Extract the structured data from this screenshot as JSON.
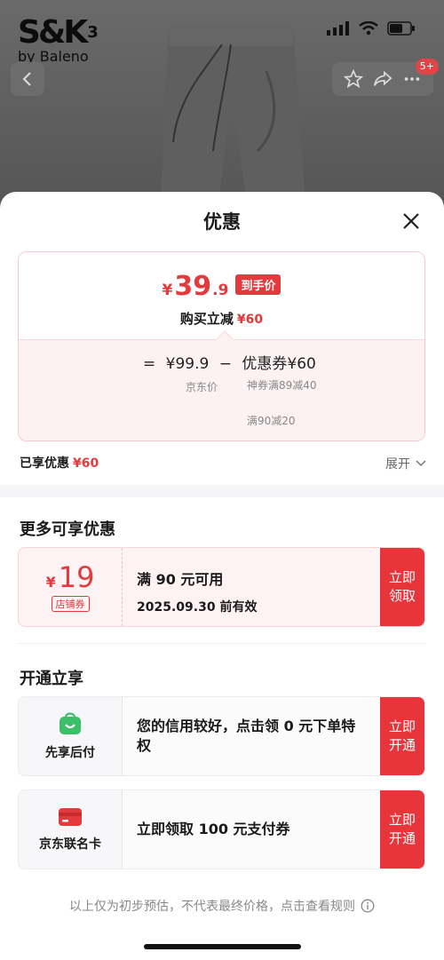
{
  "background": {
    "brand_main": "S&K",
    "brand_sup": "3",
    "brand_sub": "by Baleno",
    "cart_badge": "5+"
  },
  "sheet": {
    "title": "优惠",
    "summary": {
      "currency": "¥",
      "price_int": "39",
      "price_dec": ".9",
      "price_tag": "到手价",
      "reduce_label": "购买立减",
      "reduce_value": "¥60",
      "calc_eq": "=",
      "calc_base": "¥99.9",
      "calc_minus": "−",
      "calc_coupon": "优惠券¥60",
      "label_jd": "京东价",
      "label_coupon_a": "神券满89减40",
      "label_coupon_b": "满90减20"
    },
    "enjoyed_label": "已享优惠",
    "enjoyed_value": "¥60",
    "expand_label": "展开"
  },
  "more": {
    "title": "更多可享优惠",
    "coupon": {
      "currency": "¥",
      "amount": "19",
      "tag": "店铺券",
      "condition": "满 90 元可用",
      "expiry": "2025.09.30 前有效",
      "action": "立即领取"
    }
  },
  "open": {
    "title": "开通立享",
    "items": [
      {
        "name": "先享后付",
        "desc": "您的信用较好，点击领 0 元下单特权",
        "action": "立即开通",
        "icon": "shopping-bag-icon",
        "color": "#3dbf6a"
      },
      {
        "name": "京东联名卡",
        "desc": "立即领取 100 元支付券",
        "action": "立即开通",
        "icon": "credit-card-icon",
        "color": "#e33a3d"
      }
    ]
  },
  "footer": {
    "note": "以上仅为初步预估，不代表最终价格，点击查看规则"
  }
}
